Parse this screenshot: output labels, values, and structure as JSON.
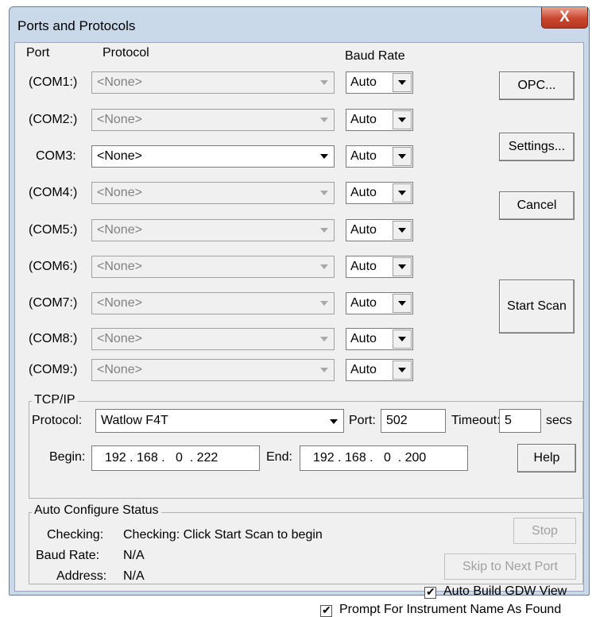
{
  "window": {
    "title": "Ports and Protocols",
    "close_glyph": "X"
  },
  "headers": {
    "port": "Port",
    "protocol": "Protocol",
    "baud_rate": "Baud Rate"
  },
  "ports": [
    {
      "label": "(COM1:)",
      "protocol": "<None>",
      "baud": "Auto"
    },
    {
      "label": "(COM2:)",
      "protocol": "<None>",
      "baud": "Auto"
    },
    {
      "label": "COM3:",
      "protocol": "<None>",
      "baud": "Auto"
    },
    {
      "label": "(COM4:)",
      "protocol": "<None>",
      "baud": "Auto"
    },
    {
      "label": "(COM5:)",
      "protocol": "<None>",
      "baud": "Auto"
    },
    {
      "label": "(COM6:)",
      "protocol": "<None>",
      "baud": "Auto"
    },
    {
      "label": "(COM7:)",
      "protocol": "<None>",
      "baud": "Auto"
    },
    {
      "label": "(COM8:)",
      "protocol": "<None>",
      "baud": "Auto"
    },
    {
      "label": "(COM9:)",
      "protocol": "<None>",
      "baud": "Auto"
    }
  ],
  "buttons": {
    "opc": "OPC...",
    "settings": "Settings...",
    "cancel": "Cancel",
    "start_scan": "Start Scan",
    "help": "Help",
    "stop": "Stop",
    "skip": "Skip to Next Port"
  },
  "tcpip": {
    "group_title": "TCP/IP",
    "protocol_label": "Protocol:",
    "protocol_value": "Watlow F4T",
    "port_label": "Port:",
    "port_value": "502",
    "timeout_label": "Timeout:",
    "timeout_value": "5",
    "secs_label": "secs",
    "begin_label": "Begin:",
    "begin_value": "192 . 168 .   0  . 222",
    "end_label": "End:",
    "end_value": "192 . 168 .   0  . 200"
  },
  "status": {
    "group_title": "Auto Configure Status",
    "checking_label": "Checking:",
    "checking_value": "Checking: Click Start Scan to begin",
    "baud_label": "Baud Rate:",
    "baud_value": "N/A",
    "address_label": "Address:",
    "address_value": "N/A",
    "auto_build_label": "Auto Build GDW View",
    "auto_build_checked": true,
    "prompt_label": "Prompt For Instrument Name As Found",
    "prompt_checked": true
  },
  "colors": {
    "title_bar": "#c9d9ea",
    "close_button": "#c9462d",
    "client_bg": "#f0f0f0"
  }
}
